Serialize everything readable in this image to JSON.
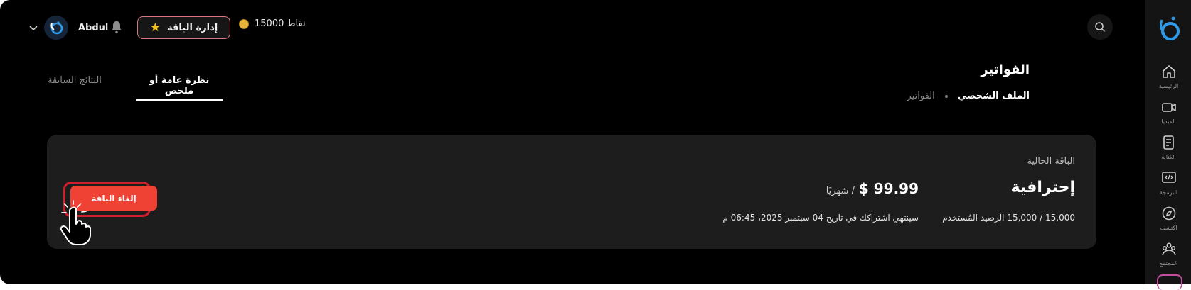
{
  "topbar": {
    "username": "Abdul",
    "manage_package_label": "إدارة الباقة",
    "points_label": "15000 نقاط",
    "icons": [
      "chevron-down-icon",
      "logo-icon",
      "bell-icon",
      "star-icon",
      "coin-icon",
      "search-icon"
    ]
  },
  "header": {
    "title": "الفواتير",
    "breadcrumb": [
      "الملف الشخصي",
      "الفواتير"
    ]
  },
  "tabs": [
    {
      "label": "نظرة عامة أو ملخص",
      "active": true
    },
    {
      "label": "النتائج السابقة",
      "active": false
    }
  ],
  "plan_card": {
    "section_label": "الباقة الحالية",
    "plan_name": "إحترافية",
    "price": "$ 99.99",
    "price_period": "/ شهريًا",
    "usage_text": "15,000 / 15,000 الرصيد المُستخدم",
    "expiry_text": "سينتهي اشتراكك في تاريخ 04 سبتمبر 2025، 06:45 م",
    "cancel_label": "إلغاء الباقة"
  },
  "sidebar": {
    "items": [
      {
        "label": "الرئيسية",
        "icon": "home-icon"
      },
      {
        "label": "الميديا",
        "icon": "video-icon"
      },
      {
        "label": "الكتابة",
        "icon": "document-icon"
      },
      {
        "label": "البرمجة",
        "icon": "code-icon"
      },
      {
        "label": "اكتشف",
        "icon": "compass-icon"
      },
      {
        "label": "المجتمع",
        "icon": "community-icon"
      }
    ]
  },
  "colors": {
    "background": "#000000",
    "card": "#1d1d1e",
    "cancel_button": "#ef4234",
    "highlight_ring": "#cf1f2a",
    "manage_border": "#d9777d",
    "star": "#f5c518"
  }
}
